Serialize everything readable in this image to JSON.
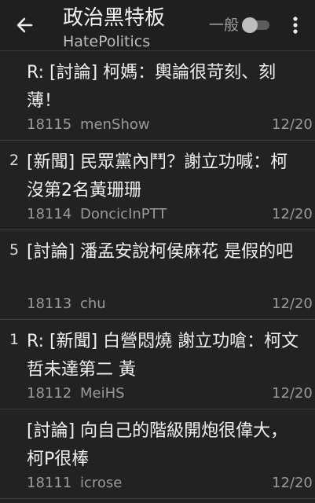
{
  "appbar": {
    "title": "政治黑特板",
    "subtitle": "HatePolitics",
    "mode_label": "一般"
  },
  "posts": [
    {
      "push": "",
      "title": "R: [討論] 柯媽：輿論很苛刻、刻薄！",
      "number": "18115",
      "author": "menShow",
      "date": "12/20"
    },
    {
      "push": "2",
      "title": "[新聞] 民眾黨內鬥？謝立功喊：柯沒第2名黃珊珊",
      "number": "18114",
      "author": "DoncicInPTT",
      "date": "12/20"
    },
    {
      "push": "5",
      "title": "[討論] 潘孟安說柯侯麻花 是假的吧",
      "number": "18113",
      "author": "chu",
      "date": "12/20"
    },
    {
      "push": "1",
      "title": "R: [新聞] 白營悶燒 謝立功嗆：柯文哲未達第二 黃",
      "number": "18112",
      "author": "MeiHS",
      "date": "12/20"
    },
    {
      "push": "",
      "title": "[討論] 向自己的階級開炮很偉大，柯P很棒",
      "number": "18111",
      "author": "icrose",
      "date": "12/20"
    }
  ]
}
